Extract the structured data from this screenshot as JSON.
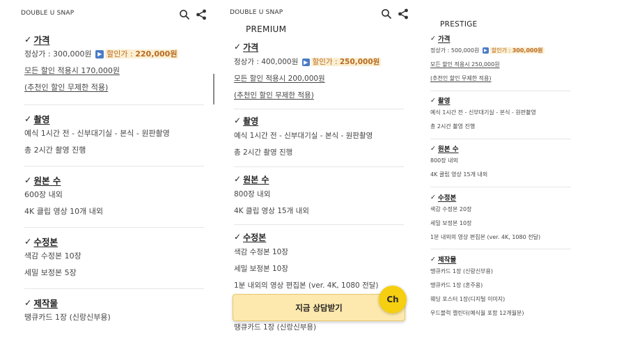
{
  "brand": "DOUBLE U SNAP",
  "icons": {
    "search": "search-icon",
    "share": "share-icon",
    "check": "checkmark-icon",
    "play": "play-icon",
    "chat": "kakao-channel-icon"
  },
  "colors": {
    "sale_bg": "#fbefd2",
    "sale_text": "#b86a22",
    "cta_bg": "#fde9ad",
    "chat_bg": "#f5cf10",
    "play_bg": "#4a7cc6"
  },
  "check_mark": "✓",
  "play_symbol": "▶",
  "panels": [
    {
      "title": "",
      "sections": {
        "price": {
          "title": "가격",
          "regular": "정상가 : 300,000원",
          "sale_label": "할인가 : ",
          "sale_value": "220,000원",
          "discount_all": "모든 할인 적용시 170,000원",
          "referral": "(추천인 할인 무제한 적용)"
        },
        "shooting": {
          "title": "촬영",
          "lines": [
            "예식 1시간 전 - 신부대기실 - 본식 - 원판촬영",
            "총 2시간 촬영 진행"
          ]
        },
        "originals": {
          "title": "원본 수",
          "lines": [
            "600장 내외",
            "4K 클립 영상 10개 내외"
          ]
        },
        "edits": {
          "title": "수정본",
          "lines": [
            "색감 수정본 10장",
            "세밀 보정본 5장"
          ]
        },
        "products": {
          "title": "제작물",
          "lines": [
            "땡큐카드 1장 (신랑신부용)"
          ]
        }
      }
    },
    {
      "title": "PREMIUM",
      "sections": {
        "price": {
          "title": "가격",
          "regular": "정상가 : 400,000원",
          "sale_label": "할인가 : ",
          "sale_value": "250,000원",
          "discount_all": "모든 할인 적용시 200,000원",
          "referral": "(추천인 할인 무제한 적용)"
        },
        "shooting": {
          "title": "촬영",
          "lines": [
            "예식 1시간 전 - 신부대기실 - 본식 - 원판촬영",
            "총 2시간 촬영 진행"
          ]
        },
        "originals": {
          "title": "원본 수",
          "lines": [
            "800장 내외",
            "4K 클립 영상 15개 내외"
          ]
        },
        "edits": {
          "title": "수정본",
          "lines": [
            "색감 수정본 10장",
            "세밀 보정본 10장",
            "1분 내외의 영상 편집본 (ver. 4K, 1080 전달)"
          ]
        },
        "products": {
          "title": "제작물",
          "lines": [
            "땡큐카드 1장 (신랑신부용)"
          ]
        }
      },
      "cta_label": "지금 상담받기",
      "chat_label": "Ch"
    },
    {
      "title": "PRESTIGE",
      "sections": {
        "price": {
          "title": "가격",
          "regular": "정상가 : 500,000원",
          "sale_label": "할인가 : ",
          "sale_value": "300,000원",
          "discount_all": "모든 할인 적용시 250,000원",
          "referral": "(추천인 할인 무제한 적용)"
        },
        "shooting": {
          "title": "촬영",
          "lines": [
            "예식 1시간 전 - 신부대기실 - 본식 - 원판촬영",
            "총 2시간 촬영 진행"
          ]
        },
        "originals": {
          "title": "원본 수",
          "lines": [
            "800장 내외",
            "4K 클립 영상 15개 내외"
          ]
        },
        "edits": {
          "title": "수정본",
          "lines": [
            "색감 수정본 20장",
            "세밀 보정본 10장",
            "1분 내외의 영상 편집본 (ver. 4K, 1080 전달)"
          ]
        },
        "products": {
          "title": "제작물",
          "lines": [
            "땡큐카드 1장 (신랑신부용)",
            "땡큐카드 1장 (혼주용)",
            "웨딩 포스터 1장(디지털 이미지)",
            "우드블럭 캘린더(예식월 포함 12개월분)"
          ]
        }
      }
    }
  ]
}
